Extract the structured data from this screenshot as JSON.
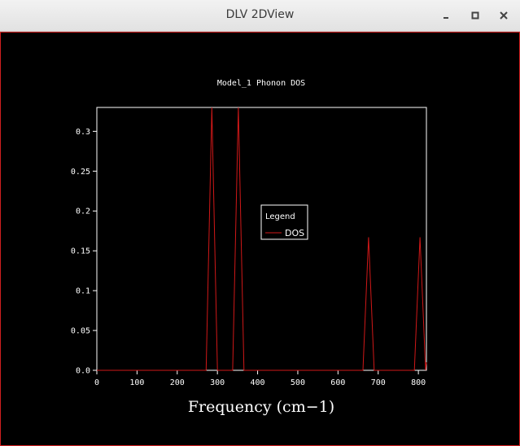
{
  "window": {
    "title": "DLV 2DView",
    "controls": {
      "minimize_icon": "minimize-icon",
      "maximize_icon": "maximize-icon",
      "close_icon": "close-icon"
    }
  },
  "colors": {
    "background": "#000000",
    "axes": "#ffffff",
    "series": "#d01818",
    "frame_border": "#d02020"
  },
  "chart_data": {
    "type": "line",
    "title": "Model_1 Phonon DOS",
    "xlabel": "Frequency (cm−1)",
    "ylabel": "",
    "xlim": [
      0,
      820
    ],
    "ylim": [
      0,
      0.33
    ],
    "x_ticks": [
      0,
      100,
      200,
      300,
      400,
      500,
      600,
      700,
      800
    ],
    "y_ticks": [
      0.0,
      0.05,
      0.1,
      0.15,
      0.2,
      0.25,
      0.3
    ],
    "x_tick_labels": [
      "0",
      "100",
      "200",
      "300",
      "400",
      "500",
      "600",
      "700",
      "800"
    ],
    "y_tick_labels": [
      "0.0",
      "0.05",
      "0.1",
      "0.15",
      "0.2",
      "0.25",
      "0.3"
    ],
    "legend": {
      "title": "Legend",
      "placement": "center"
    },
    "series": [
      {
        "name": "DOS",
        "x": [
          0,
          272,
          286,
          300,
          338,
          352,
          366,
          662,
          676,
          690,
          790,
          804,
          818,
          820
        ],
        "y": [
          0,
          0,
          0.33,
          0,
          0,
          0.33,
          0,
          0,
          0.167,
          0,
          0,
          0.167,
          0,
          0.01
        ]
      }
    ]
  }
}
